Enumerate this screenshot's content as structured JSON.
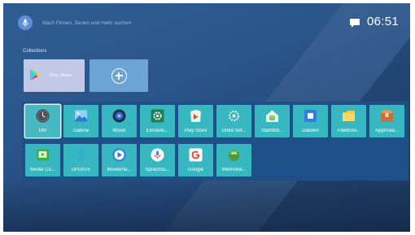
{
  "search": {
    "placeholder_text": "Nach Filmen, Serien und mehr suchen",
    "icon": "mic-icon"
  },
  "status": {
    "time": "06:51",
    "notification_icon": "message-icon"
  },
  "collections": {
    "label": "Collections",
    "items": [
      {
        "label": "Play Store",
        "icon": "play-store-icon"
      },
      {
        "label": "",
        "icon": "add-icon"
      }
    ]
  },
  "apps": {
    "row1": [
      {
        "label": "Uhr",
        "icon": "clock-icon",
        "selected": true
      },
      {
        "label": "Galerie",
        "icon": "gallery-icon"
      },
      {
        "label": "Musik",
        "icon": "music-icon"
      },
      {
        "label": "Einstellu...",
        "icon": "settings-icon"
      },
      {
        "label": "Play Store",
        "icon": "play-store-icon"
      },
      {
        "label": "Droid Set...",
        "icon": "droid-settings-icon"
      },
      {
        "label": "Startbild...",
        "icon": "home-icon"
      },
      {
        "label": "Dateien",
        "icon": "files-icon"
      },
      {
        "label": "FileBrow...",
        "icon": "folder-icon"
      },
      {
        "label": "AppInsta...",
        "icon": "app-installer-icon"
      }
    ],
    "row2": [
      {
        "label": "Media Ce...",
        "icon": "media-center-icon"
      },
      {
        "label": "UPDATE",
        "icon": "update-icon"
      },
      {
        "label": "MoviePla...",
        "icon": "movie-player-icon"
      },
      {
        "label": "Sprachsu...",
        "icon": "voice-search-icon"
      },
      {
        "label": "Google",
        "icon": "google-icon"
      },
      {
        "label": "WebView...",
        "icon": "webview-icon"
      }
    ]
  },
  "colors": {
    "tile": "#37b7bf",
    "panel": "#1d4f88",
    "background": "#2a558a",
    "accent": "#5e8fd8"
  }
}
